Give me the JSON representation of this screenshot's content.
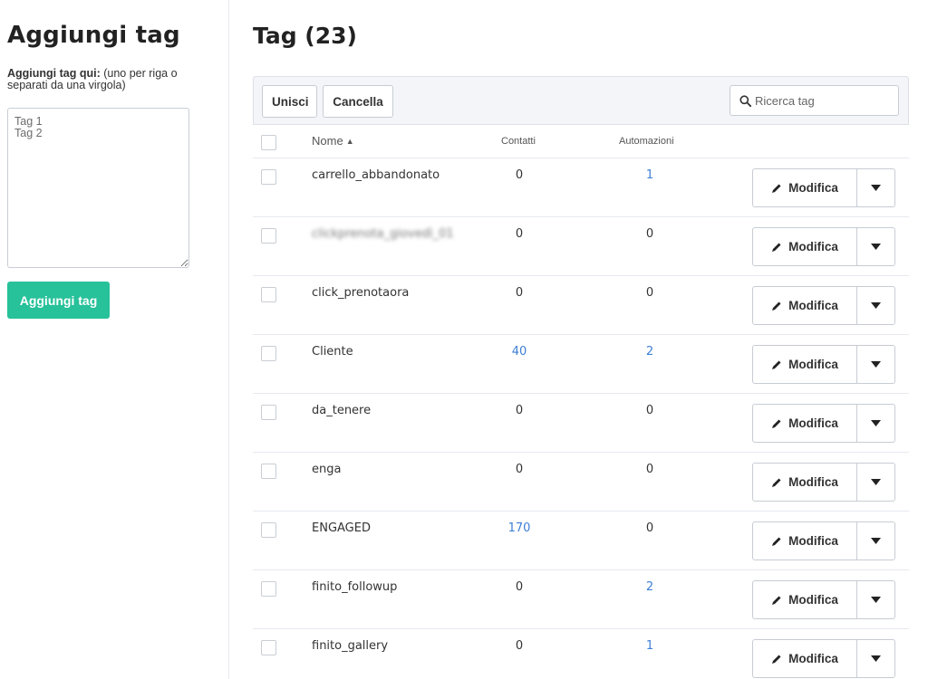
{
  "sidebar": {
    "title": "Aggiungi tag",
    "help_bold": "Aggiungi tag qui:",
    "help_text": " (uno per riga o separati da una virgola)",
    "textarea_placeholder": "Tag 1\nTag 2",
    "add_button": "Aggiungi tag"
  },
  "main": {
    "title": "Tag (23)",
    "toolbar": {
      "merge_label": "Unisci",
      "delete_label": "Cancella",
      "search_placeholder": "Ricerca tag",
      "search_icon": "search-icon"
    },
    "columns": {
      "name": "Nome",
      "sort_arrow": "▲",
      "contacts": "Contatti",
      "automations": "Automazioni"
    },
    "edit_label": "Modifica",
    "link_color": "#3d7fd6",
    "rows": [
      {
        "name": "carrello_abbandonato",
        "contacts": "0",
        "automations": "1"
      },
      {
        "name": "clickprenota_giovedì_01",
        "contacts": "0",
        "automations": "0"
      },
      {
        "name": "click_prenotaora",
        "contacts": "0",
        "automations": "0"
      },
      {
        "name": "Cliente",
        "contacts": "40",
        "automations": "2"
      },
      {
        "name": "da_tenere",
        "contacts": "0",
        "automations": "0"
      },
      {
        "name": "enga",
        "contacts": "0",
        "automations": "0"
      },
      {
        "name": "ENGAGED",
        "contacts": "170",
        "automations": "0"
      },
      {
        "name": "finito_followup",
        "contacts": "0",
        "automations": "2"
      },
      {
        "name": "finito_gallery",
        "contacts": "0",
        "automations": "1"
      }
    ]
  }
}
